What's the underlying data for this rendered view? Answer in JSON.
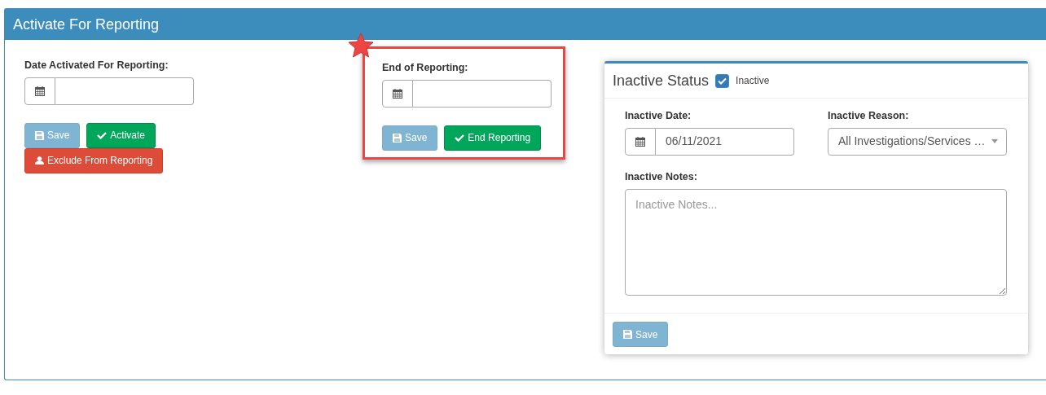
{
  "panel": {
    "title": "Activate For Reporting"
  },
  "activate": {
    "label": "Date Activated For Reporting:",
    "buttons": [
      {
        "kind": "save",
        "label": "Save",
        "disabled": true
      },
      {
        "kind": "check",
        "label": "Activate",
        "disabled": false
      },
      {
        "kind": "exclude",
        "label": "Exclude From Reporting",
        "disabled": false
      }
    ]
  },
  "end_reporting": {
    "highlighted": true,
    "label": "End of Reporting:",
    "buttons": [
      {
        "kind": "save",
        "label": "Save",
        "disabled": true
      },
      {
        "kind": "check",
        "label": "End Reporting",
        "disabled": false
      }
    ]
  },
  "inactive_status": {
    "title": "Inactive Status",
    "checkbox": {
      "label": "Inactive",
      "checked": true
    },
    "date": {
      "label": "Inactive Date:",
      "value": "06/11/2021"
    },
    "reason": {
      "label": "Inactive Reason:",
      "value": "All Investigations/Services …"
    },
    "notes": {
      "label": "Inactive Notes:",
      "placeholder": "Inactive Notes..."
    },
    "save": {
      "label": "Save",
      "disabled": true
    }
  }
}
